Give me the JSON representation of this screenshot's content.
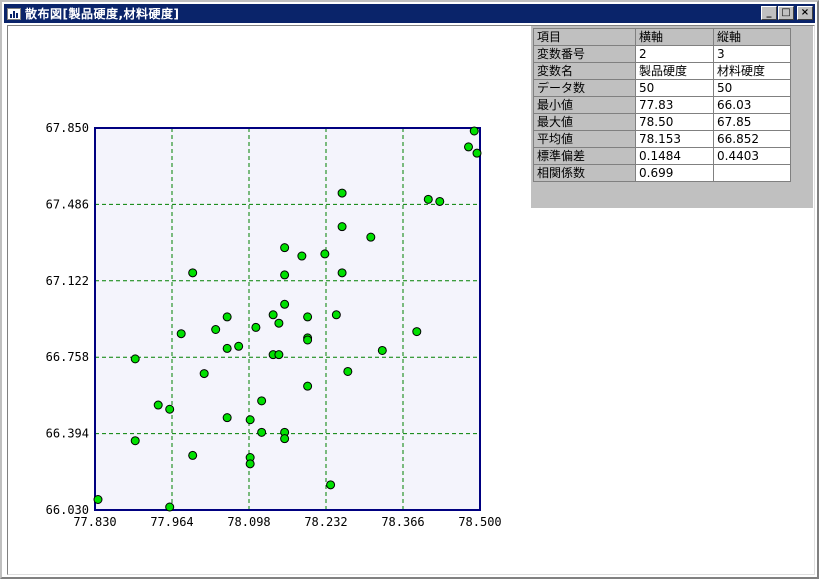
{
  "window": {
    "title": "散布図[製品硬度,材料硬度]",
    "minimize_label": "_",
    "maximize_label": "□",
    "close_label": "×"
  },
  "stats": {
    "rows": [
      [
        "項目",
        "横軸",
        "縦軸"
      ],
      [
        "変数番号",
        " 2",
        " 3"
      ],
      [
        "変数名",
        "製品硬度",
        "材料硬度"
      ],
      [
        "データ数",
        "50",
        "50"
      ],
      [
        "最小値",
        "77.83",
        "66.03"
      ],
      [
        "最大値",
        "78.50",
        "67.85"
      ],
      [
        "平均値",
        "78.153",
        "66.852"
      ],
      [
        "標準偏差",
        " 0.1484",
        " 0.4403"
      ],
      [
        "相関係数",
        " 0.699",
        ""
      ]
    ]
  },
  "chart_data": {
    "type": "scatter",
    "title": "",
    "xlabel": "",
    "ylabel": "",
    "xlim": [
      77.83,
      78.5
    ],
    "ylim": [
      66.03,
      67.85
    ],
    "x_ticks": [
      "77.830",
      "77.964",
      "78.098",
      "78.232",
      "78.366",
      "78.500"
    ],
    "y_ticks": [
      "67.850",
      "67.486",
      "67.122",
      "66.758",
      "66.394",
      "66.030"
    ],
    "grid": true,
    "point_color": "#00e000",
    "grid_color": "#008000",
    "frame_color": "#000080",
    "plot_background": "#f4f4fc",
    "points": [
      [
        77.83,
        66.08
      ],
      [
        77.9,
        66.36
      ],
      [
        77.9,
        66.75
      ],
      [
        77.94,
        66.53
      ],
      [
        77.96,
        66.51
      ],
      [
        77.96,
        66.02
      ],
      [
        77.98,
        66.87
      ],
      [
        78.0,
        66.29
      ],
      [
        78.0,
        67.16
      ],
      [
        78.02,
        66.68
      ],
      [
        78.04,
        66.89
      ],
      [
        78.06,
        66.95
      ],
      [
        78.06,
        66.8
      ],
      [
        78.06,
        66.47
      ],
      [
        78.08,
        66.81
      ],
      [
        78.1,
        66.28
      ],
      [
        78.1,
        66.25
      ],
      [
        78.1,
        66.46
      ],
      [
        78.11,
        66.9
      ],
      [
        78.12,
        66.4
      ],
      [
        78.12,
        66.55
      ],
      [
        78.14,
        66.96
      ],
      [
        78.14,
        66.77
      ],
      [
        78.15,
        66.77
      ],
      [
        78.15,
        66.92
      ],
      [
        78.16,
        67.01
      ],
      [
        78.16,
        67.15
      ],
      [
        78.16,
        67.28
      ],
      [
        78.16,
        66.4
      ],
      [
        78.16,
        66.37
      ],
      [
        78.19,
        67.24
      ],
      [
        78.2,
        66.95
      ],
      [
        78.2,
        66.85
      ],
      [
        78.2,
        66.84
      ],
      [
        78.2,
        66.62
      ],
      [
        78.23,
        67.25
      ],
      [
        78.24,
        66.15
      ],
      [
        78.25,
        66.96
      ],
      [
        78.26,
        67.16
      ],
      [
        78.26,
        67.38
      ],
      [
        78.26,
        67.54
      ],
      [
        78.27,
        66.69
      ],
      [
        78.31,
        67.33
      ],
      [
        78.33,
        66.79
      ],
      [
        78.39,
        66.88
      ],
      [
        78.41,
        67.51
      ],
      [
        78.43,
        67.5
      ],
      [
        78.48,
        67.76
      ],
      [
        78.49,
        67.85
      ],
      [
        78.55,
        67.73
      ]
    ]
  }
}
